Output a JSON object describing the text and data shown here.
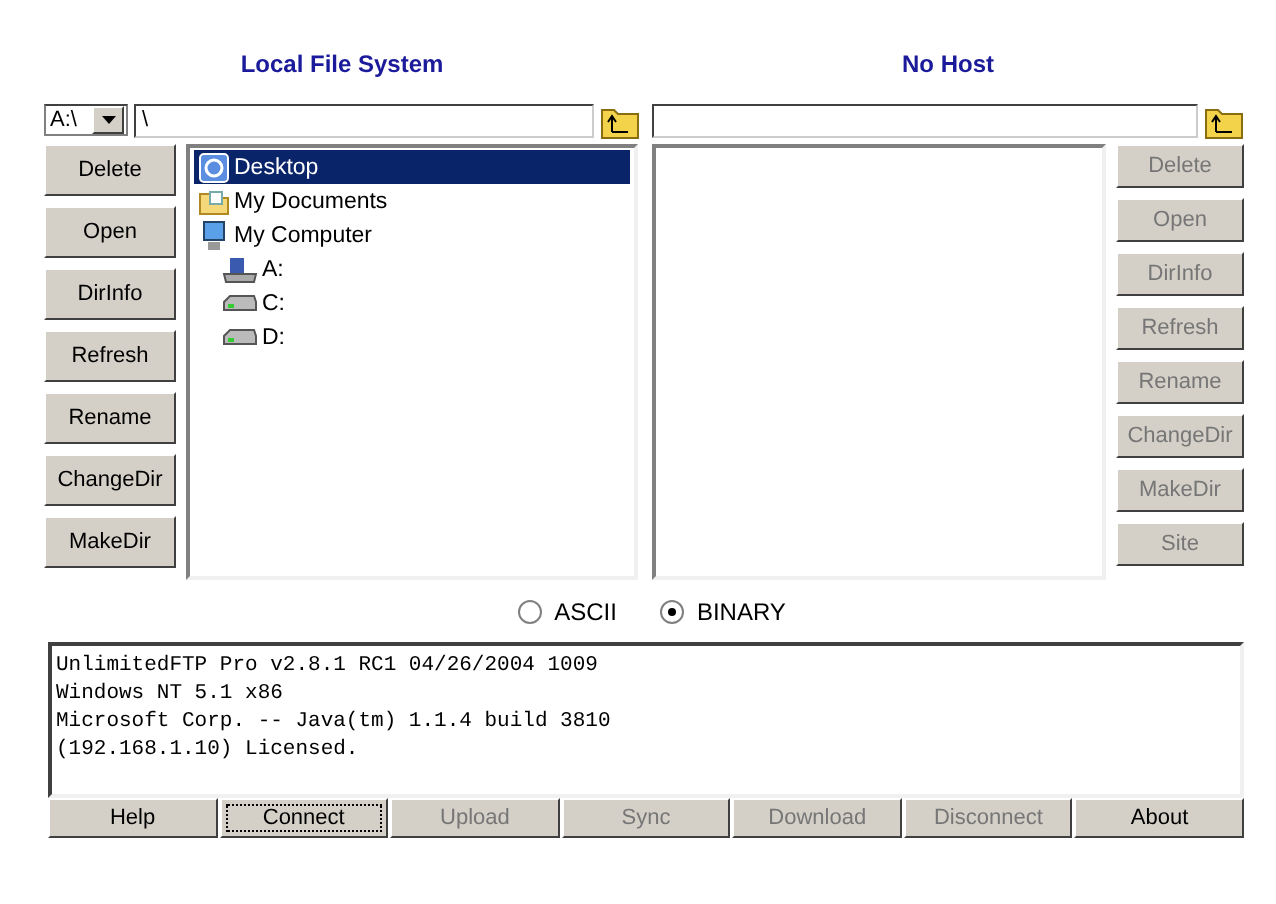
{
  "local": {
    "title": "Local File System",
    "drive": "A:\\",
    "path": "\\",
    "buttons": [
      {
        "label": "Delete",
        "disabled": false
      },
      {
        "label": "Open",
        "disabled": false
      },
      {
        "label": "DirInfo",
        "disabled": false
      },
      {
        "label": "Refresh",
        "disabled": false
      },
      {
        "label": "Rename",
        "disabled": false
      },
      {
        "label": "ChangeDir",
        "disabled": false
      },
      {
        "label": "MakeDir",
        "disabled": false
      }
    ],
    "tree": [
      {
        "label": "Desktop",
        "kind": "desktop",
        "selected": true
      },
      {
        "label": "My Documents",
        "kind": "documents",
        "selected": false
      },
      {
        "label": "My Computer",
        "kind": "computer",
        "selected": false,
        "children": [
          {
            "label": "A:",
            "kind": "floppy",
            "selected": false
          },
          {
            "label": "C:",
            "kind": "drive",
            "selected": false
          },
          {
            "label": "D:",
            "kind": "drive",
            "selected": false
          }
        ]
      }
    ]
  },
  "remote": {
    "title": "No Host",
    "buttons": [
      {
        "label": "Delete",
        "disabled": true
      },
      {
        "label": "Open",
        "disabled": true
      },
      {
        "label": "DirInfo",
        "disabled": true
      },
      {
        "label": "Refresh",
        "disabled": true
      },
      {
        "label": "Rename",
        "disabled": true
      },
      {
        "label": "ChangeDir",
        "disabled": true
      },
      {
        "label": "MakeDir",
        "disabled": true
      },
      {
        "label": "Site",
        "disabled": true
      }
    ]
  },
  "transfer_mode": [
    {
      "label": "ASCII",
      "selected": false
    },
    {
      "label": "BINARY",
      "selected": true
    }
  ],
  "log": [
    "UnlimitedFTP Pro v2.8.1 RC1 04/26/2004 1009",
    "Windows NT 5.1 x86",
    "Microsoft Corp. -- Java(tm) 1.1.4 build 3810",
    "(192.168.1.10) Licensed."
  ],
  "bottom_buttons": [
    {
      "label": "Help",
      "disabled": false,
      "focused": false
    },
    {
      "label": "Connect",
      "disabled": false,
      "focused": true
    },
    {
      "label": "Upload",
      "disabled": true,
      "focused": false
    },
    {
      "label": "Sync",
      "disabled": true,
      "focused": false
    },
    {
      "label": "Download",
      "disabled": true,
      "focused": false
    },
    {
      "label": "Disconnect",
      "disabled": true,
      "focused": false
    },
    {
      "label": "About",
      "disabled": false,
      "focused": false
    }
  ]
}
